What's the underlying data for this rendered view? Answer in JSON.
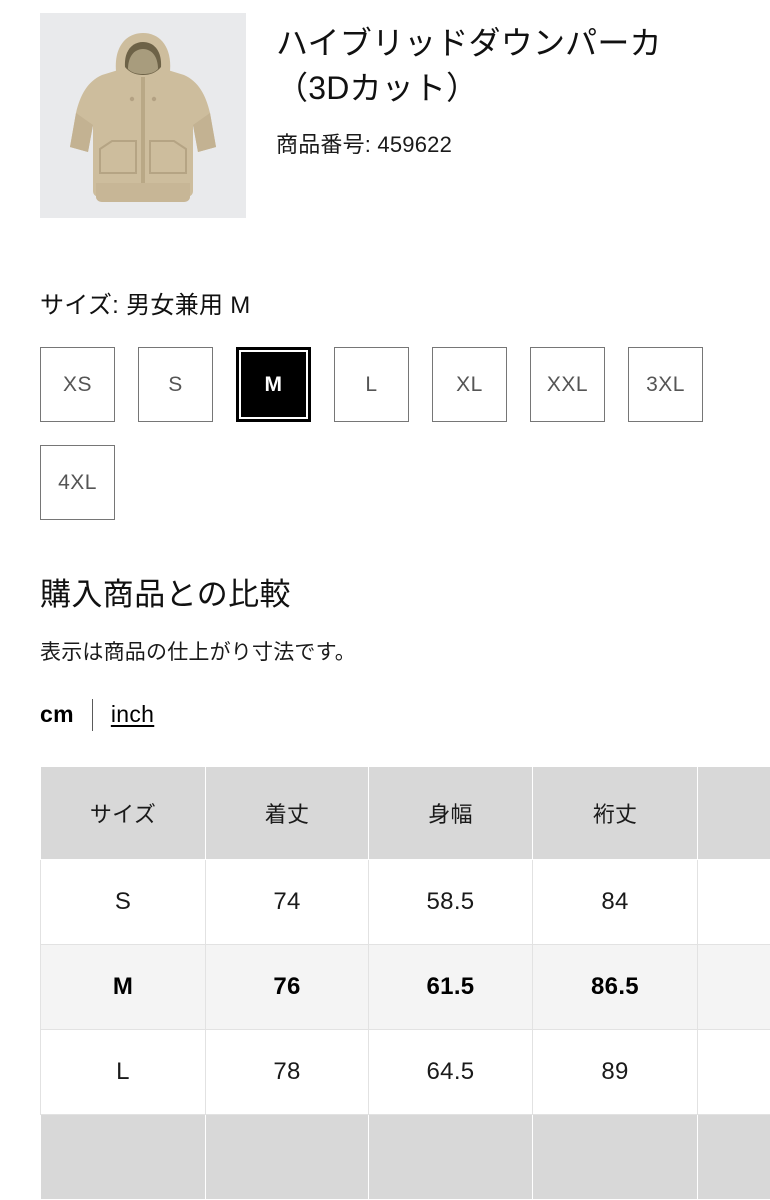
{
  "product": {
    "image_alt": "beige-hooded-down-parka",
    "title": "ハイブリッドダウンパーカ（3Dカット）",
    "code_label": "商品番号: 459622"
  },
  "size_selector": {
    "label": "サイズ: 男女兼用 M",
    "selected": "M",
    "options": [
      {
        "label": "XS"
      },
      {
        "label": "S"
      },
      {
        "label": "M"
      },
      {
        "label": "L"
      },
      {
        "label": "XL"
      },
      {
        "label": "XXL"
      },
      {
        "label": "3XL"
      },
      {
        "label": "4XL"
      }
    ]
  },
  "compare": {
    "heading": "購入商品との比較",
    "note": "表示は商品の仕上がり寸法です。",
    "unit_active": "cm",
    "unit_link": "inch"
  },
  "chart_data": {
    "type": "table",
    "title": "購入商品との比較",
    "unit": "cm",
    "columns": [
      "サイズ",
      "着丈",
      "身幅",
      "裄丈",
      ""
    ],
    "rows": [
      {
        "cells": [
          "S",
          "74",
          "58.5",
          "84",
          ""
        ],
        "highlight": false
      },
      {
        "cells": [
          "M",
          "76",
          "61.5",
          "86.5",
          ""
        ],
        "highlight": true
      },
      {
        "cells": [
          "L",
          "78",
          "64.5",
          "89",
          ""
        ],
        "highlight": false
      }
    ]
  },
  "colors": {
    "selected_size_bg": "#000000",
    "table_header_bg": "#d8d8d8",
    "highlight_row_bg": "#f4f4f4",
    "thumb_bg": "#e9eaec",
    "garment": "#cdbd9d"
  }
}
